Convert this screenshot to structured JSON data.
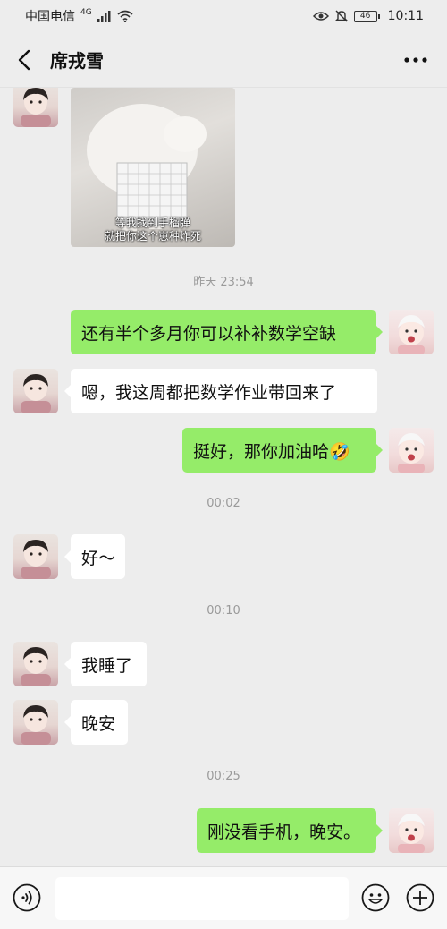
{
  "status_bar": {
    "carrier": "中国电信",
    "network": "4G",
    "battery": "46",
    "time": "10:11"
  },
  "header": {
    "contact_name": "席戎雪",
    "back_icon": "chevron-left-icon",
    "more_icon": "more-dots-icon"
  },
  "messages": {
    "photo_caption_line1": "等我找到手榴弹",
    "photo_caption_line2": "就把你这个崽种炸死",
    "time1": "昨天 23:54",
    "m1": "还有半个多月你可以补补数学空缺",
    "m2": "嗯，我这周都把数学作业带回来了",
    "m3": "挺好，那你加油哈🤣",
    "time2": "00:02",
    "m4": "好～",
    "time3": "00:10",
    "m5": "我睡了",
    "m6": "晚安",
    "time4": "00:25",
    "m7": "刚没看手机，晚安。"
  },
  "input_bar": {
    "voice_icon": "voice-icon",
    "emoji_icon": "emoji-icon",
    "plus_icon": "plus-icon"
  },
  "colors": {
    "background": "#ededed",
    "outgoing_bubble": "#95ec69",
    "incoming_bubble": "#ffffff"
  }
}
